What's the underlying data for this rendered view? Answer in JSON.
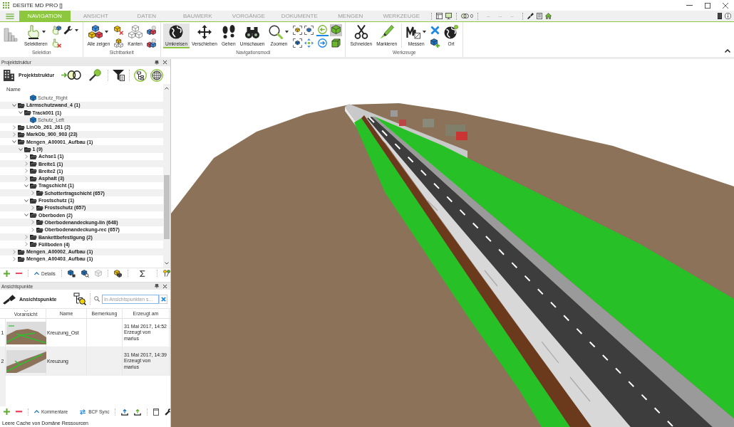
{
  "window": {
    "title": "DESITE MD PRO []"
  },
  "menu_tabs": [
    {
      "label": "NAVIGATION",
      "selected": true
    },
    {
      "label": "ANSICHT",
      "selected": false
    },
    {
      "label": "DATEN",
      "selected": false
    },
    {
      "label": "BAUWERK",
      "selected": false
    },
    {
      "label": "VORGÄNGE",
      "selected": false
    },
    {
      "label": "DOKUMENTE",
      "selected": false
    },
    {
      "label": "MENGEN",
      "selected": false
    },
    {
      "label": "WERKZEUGE",
      "selected": false
    }
  ],
  "quick_toolbar": {
    "count": "0",
    "dashes": [
      "--",
      "--",
      "--"
    ]
  },
  "ribbon": {
    "groups": [
      {
        "label": "Selektion",
        "items": [
          {
            "kind": "icon"
          },
          {
            "kind": "large",
            "label": "Selektieren",
            "dropdown": true
          },
          {
            "kind": "stack"
          }
        ]
      },
      {
        "label": "Sichtbarkeit",
        "items": [
          {
            "kind": "large",
            "label": "Alle zeigen",
            "dropdown": true
          },
          {
            "kind": "stack"
          },
          {
            "kind": "large",
            "label": "Kanten",
            "dropdown": false
          },
          {
            "kind": "stack"
          }
        ]
      },
      {
        "label": "Navigationsmodi",
        "items": [
          {
            "kind": "large",
            "label": "Umkreisen",
            "dropdown": false,
            "selected": true
          },
          {
            "kind": "large",
            "label": "Verschieben",
            "dropdown": false,
            "selected": false
          },
          {
            "kind": "large",
            "label": "Gehen",
            "dropdown": false,
            "selected": false
          },
          {
            "kind": "large",
            "label": "Umschauen",
            "dropdown": false,
            "selected": false
          },
          {
            "kind": "large",
            "label": "Zoomen",
            "dropdown": true,
            "selected": false
          },
          {
            "kind": "stack"
          },
          {
            "kind": "history",
            "toggles": [
              {
                "selected": true
              },
              {
                "selected": false
              }
            ]
          },
          {
            "kind": "toggles",
            "toggles": [
              {
                "selected": true
              },
              {
                "selected": false
              }
            ]
          }
        ]
      },
      {
        "label": "Werkzeuge",
        "items": [
          {
            "kind": "large",
            "label": "Schneiden",
            "dropdown": false
          },
          {
            "kind": "large",
            "label": "Markieren",
            "dropdown": false
          },
          {
            "kind": "separator"
          },
          {
            "kind": "large",
            "label": "Messen",
            "dropdown": true
          },
          {
            "kind": "stack"
          },
          {
            "kind": "large",
            "label": "Ort",
            "dropdown": false
          }
        ]
      }
    ]
  },
  "project_panel": {
    "title": "Projektstruktur",
    "toolbar_title": "Projektstruktur",
    "column": "Name",
    "tree": [
      {
        "children": [
          {
            "children": [
              {
                "label": "Schutz_Right",
                "kind": "object"
              }
            ]
          }
        ]
      },
      {
        "label": "Lärmschutzwand_4 (1)",
        "kind": "folder",
        "expanded": true,
        "children": [
          {
            "label": "Track001 (1)",
            "kind": "folder",
            "expanded": true,
            "children": [
              {
                "label": "Schutz_Left",
                "kind": "object"
              }
            ]
          }
        ]
      },
      {
        "label": "LinOb_261_261 (2)",
        "kind": "folder",
        "expanded": false
      },
      {
        "label": "MarkOb_900_903 (23)",
        "kind": "folder",
        "expanded": false
      },
      {
        "label": "Mengen_A00001_Aufbau (1)",
        "kind": "folder",
        "expanded": true,
        "children": [
          {
            "label": "1 (9)",
            "kind": "folder",
            "expanded": true,
            "children": [
              {
                "label": "Achse1 (1)",
                "kind": "folder",
                "expanded": false
              },
              {
                "label": "Breite1 (1)",
                "kind": "folder",
                "expanded": false
              },
              {
                "label": "Breite2 (1)",
                "kind": "folder",
                "expanded": false
              },
              {
                "label": "Asphalt (3)",
                "kind": "folder",
                "expanded": false
              },
              {
                "label": "Tragschicht (1)",
                "kind": "folder",
                "expanded": true,
                "children": [
                  {
                    "label": "Schottertragschicht (657)",
                    "kind": "folder",
                    "expanded": false
                  }
                ]
              },
              {
                "label": "Frostschutz (1)",
                "kind": "folder",
                "expanded": true,
                "children": [
                  {
                    "label": "Frostschutz (657)",
                    "kind": "folder",
                    "expanded": false
                  }
                ]
              },
              {
                "label": "Oberboden (2)",
                "kind": "folder",
                "expanded": true,
                "children": [
                  {
                    "label": "Oberbodenandeckung-lin (648)",
                    "kind": "folder",
                    "expanded": false
                  },
                  {
                    "label": "Oberbodenandeckung-rec (657)",
                    "kind": "folder",
                    "expanded": false
                  }
                ]
              },
              {
                "label": "Bankettbefestigung (2)",
                "kind": "folder",
                "expanded": false
              },
              {
                "label": "Füllboden (4)",
                "kind": "folder",
                "expanded": false
              }
            ]
          }
        ]
      },
      {
        "label": "Mengen_A00002_Aufbau (1)",
        "kind": "folder",
        "expanded": false
      },
      {
        "label": "Mengen_A00403_Aufbau (1)",
        "kind": "folder",
        "expanded": false
      }
    ],
    "footer_button": "Details"
  },
  "viewpoint_panel": {
    "title": "Ansichtspunkte",
    "toolbar_title": "Ansichtspunkte",
    "search": {
      "placeholder": "In Ansichtspunkten s..."
    },
    "columns": [
      {
        "label": "Voransicht",
        "sorted": true
      },
      {
        "label": "Name",
        "sorted": false
      },
      {
        "label": "Bemerkung",
        "sorted": false
      },
      {
        "label": "Erzeugt am",
        "sorted": false
      }
    ],
    "rows": [
      {
        "number": "1",
        "name": "Kreuzung_Ost",
        "created": "31 Mai 2017, 14:52",
        "author": "Erzeugt von marius"
      },
      {
        "number": "2",
        "name": "Kreuzung",
        "created": "31 Mai 2017, 14:39",
        "author": "Erzeugt von marius"
      }
    ],
    "footer_buttons": [
      "Kommentare",
      "BCF Sync"
    ]
  },
  "status_bar": {
    "text": "Leere Cache von Domäne Ressourcen"
  }
}
